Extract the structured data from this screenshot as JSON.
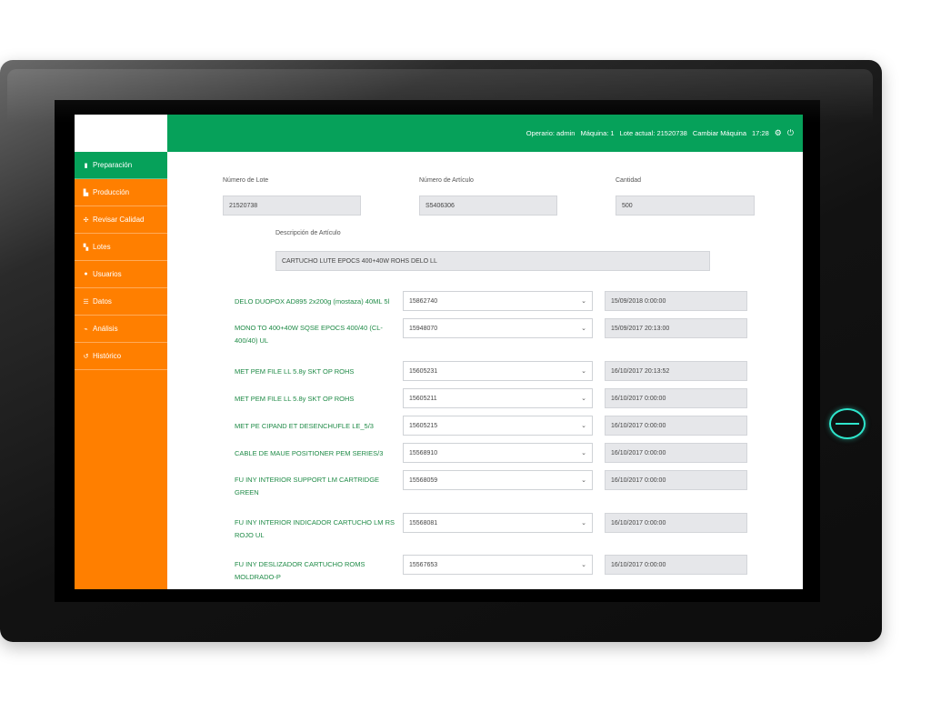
{
  "topbar": {
    "operator": "Operario: admin",
    "machine": "Máquina: 1",
    "batch": "Lote actual: 21520738",
    "change_machine": "Cambiar Máquina",
    "time": "17:28"
  },
  "sidebar": {
    "items": [
      {
        "label": "Preparación",
        "icon": "clipboard-icon"
      },
      {
        "label": "Producción",
        "icon": "factory-icon"
      },
      {
        "label": "Revisar Calidad",
        "icon": "quality-icon"
      },
      {
        "label": "Lotes",
        "icon": "boxes-icon"
      },
      {
        "label": "Usuarios",
        "icon": "user-icon"
      },
      {
        "label": "Datos",
        "icon": "list-icon"
      },
      {
        "label": "Análisis",
        "icon": "chart-icon"
      },
      {
        "label": "Histórico",
        "icon": "history-icon"
      }
    ]
  },
  "form": {
    "lot_number_label": "Número de Lote",
    "lot_number_value": "21520738",
    "article_number_label": "Número de Artículo",
    "article_number_value": "S5406306",
    "quantity_label": "Cantidad",
    "quantity_value": "500",
    "description_label": "Descripción de Artículo",
    "description_value": "CARTUCHO LUTE EPOCS 400+40W ROHS DELO LL"
  },
  "components": [
    {
      "name": "DELO DUOPOX AD895 2x200g (mostaza) 40ML 5l",
      "lot": "15862740",
      "date": "15/09/2018 0:00:00"
    },
    {
      "name": "MONO TO 400+40W SQSE EPOCS 400/40 (CL-400/40) UL",
      "lot": "15948070",
      "date": "15/09/2017 20:13:00"
    },
    {
      "name": "MET PEM FILE LL 5.8y SKT OP ROHS",
      "lot": "15605231",
      "date": "16/10/2017 20:13:52"
    },
    {
      "name": "MET PEM FILE LL 5.8y SKT OP ROHS",
      "lot": "15605211",
      "date": "16/10/2017 0:00:00"
    },
    {
      "name": "MET PE CIPAND ET DESENCHUFLE LE_5/3",
      "lot": "15605215",
      "date": "16/10/2017 0:00:00"
    },
    {
      "name": "CABLE DE MAUE POSITIONER PEM SERIES/3",
      "lot": "15568910",
      "date": "16/10/2017 0:00:00"
    },
    {
      "name": "FU INY INTERIOR SUPPORT LM CARTRIDGE GREEN",
      "lot": "15568059",
      "date": "16/10/2017 0:00:00"
    },
    {
      "name": "FU INY INTERIOR INDICADOR CARTUCHO LM RS ROJO UL",
      "lot": "15568081",
      "date": "16/10/2017 0:00:00"
    },
    {
      "name": "FU INY DESLIZADOR CARTUCHO ROMS MOLDRADO-P",
      "lot": "15567653",
      "date": "16/10/2017 0:00:00"
    }
  ]
}
